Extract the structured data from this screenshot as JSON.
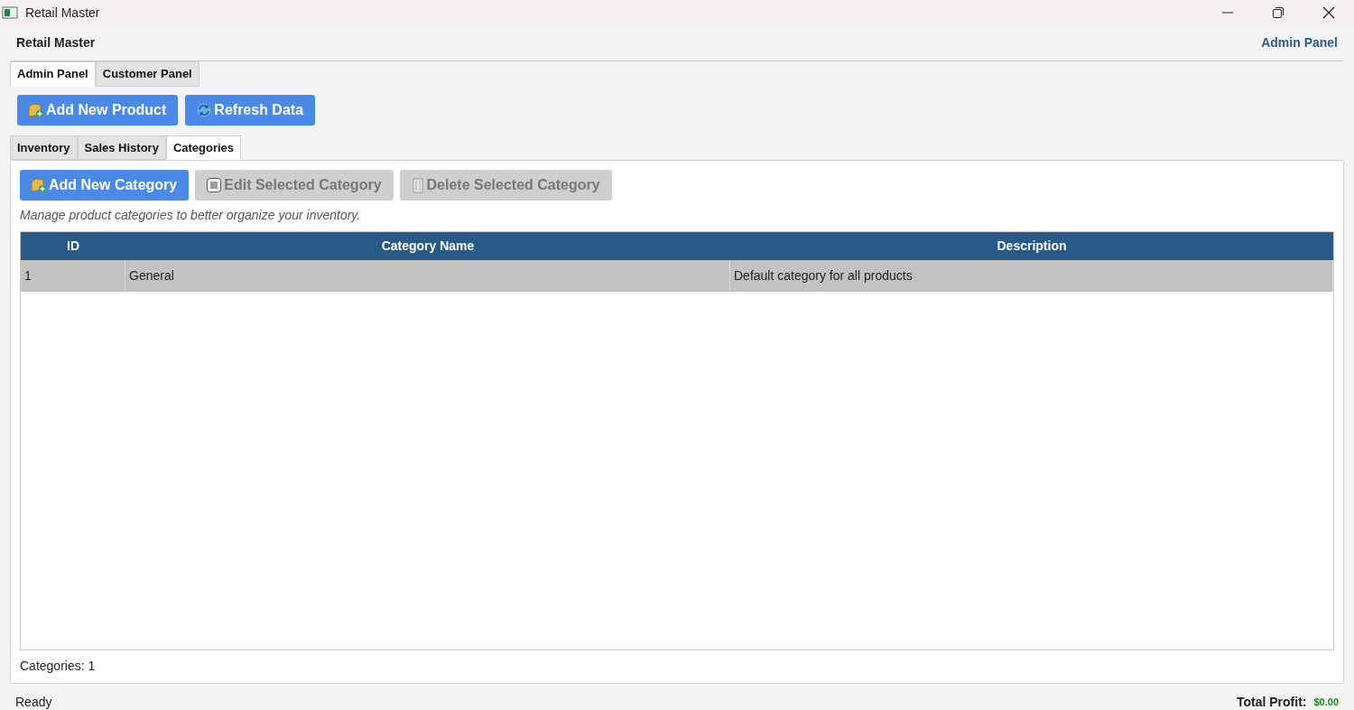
{
  "window": {
    "title": "Retail Master"
  },
  "header": {
    "title": "Retail Master",
    "panel_label": "Admin Panel"
  },
  "main_tabs": [
    {
      "label": "Admin Panel",
      "selected": true
    },
    {
      "label": "Customer Panel",
      "selected": false
    }
  ],
  "toolbar": [
    {
      "label": "Add New Product"
    },
    {
      "label": "Refresh Data"
    }
  ],
  "sub_tabs": [
    {
      "label": "Inventory",
      "selected": false
    },
    {
      "label": "Sales History",
      "selected": false
    },
    {
      "label": "Categories",
      "selected": true
    }
  ],
  "category_actions": [
    {
      "label": "Add New Category",
      "disabled": false
    },
    {
      "label": "Edit Selected Category",
      "disabled": true
    },
    {
      "label": "Delete Selected Category",
      "disabled": true
    }
  ],
  "hint": "Manage product categories to better organize your inventory.",
  "table": {
    "columns": [
      "ID",
      "Category Name",
      "Description"
    ],
    "rows": [
      {
        "cells": [
          "1",
          "General",
          "Default category for all products"
        ],
        "selected": true
      }
    ]
  },
  "count_label": "Categories: 1",
  "status_bar": {
    "status": "Ready",
    "profit_label": "Total Profit:",
    "profit_value": "$0.00"
  }
}
